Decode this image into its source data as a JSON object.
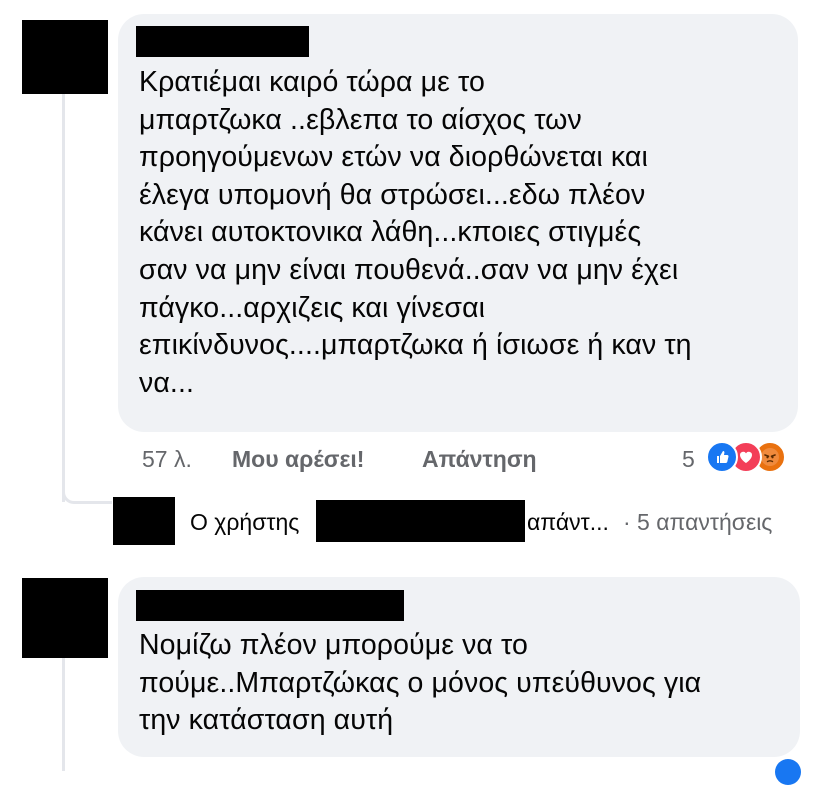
{
  "comments": [
    {
      "text": "Κρατιέμαι καιρό τώρα με το\nμπαρτζωκα ..εβλεπα το αίσχος των\nπροηγούμενων ετών να διορθώνεται και\nέλεγα υπομονή θα στρώσει...εδω πλέον\nκάνει αυτοκτονικα λάθη...κποιες στιγμές\nσαν να μην είναι πουθενά..σαν να μην έχει\nπάγκο...αρχιζεις και γίνεσαι\nεπικίνδυνος....μπαρτζωκα ή ίσιωσε ή καν τη\nνα...",
      "time": "57 λ.",
      "like_label": "Μου αρέσει!",
      "reply_label": "Απάντηση",
      "reaction_count": "5",
      "reactions": [
        "like-icon",
        "love-icon",
        "angry-icon"
      ],
      "reply_preview": {
        "prefix": "Ο χρήστης",
        "suffix": "απάντ...",
        "count": "· 5 απαντήσεις"
      }
    },
    {
      "text": "Νομίζω πλέον μπορούμε να το\nπούμε..Μπαρτζώκας ο μόνος υπεύθυνος για\nτην κατάσταση αυτή"
    }
  ],
  "colors": {
    "bubble": "#f0f2f5",
    "like": "#1877f2",
    "love": "#f33e58",
    "angry": "#e9710f",
    "meta": "#65676b"
  }
}
